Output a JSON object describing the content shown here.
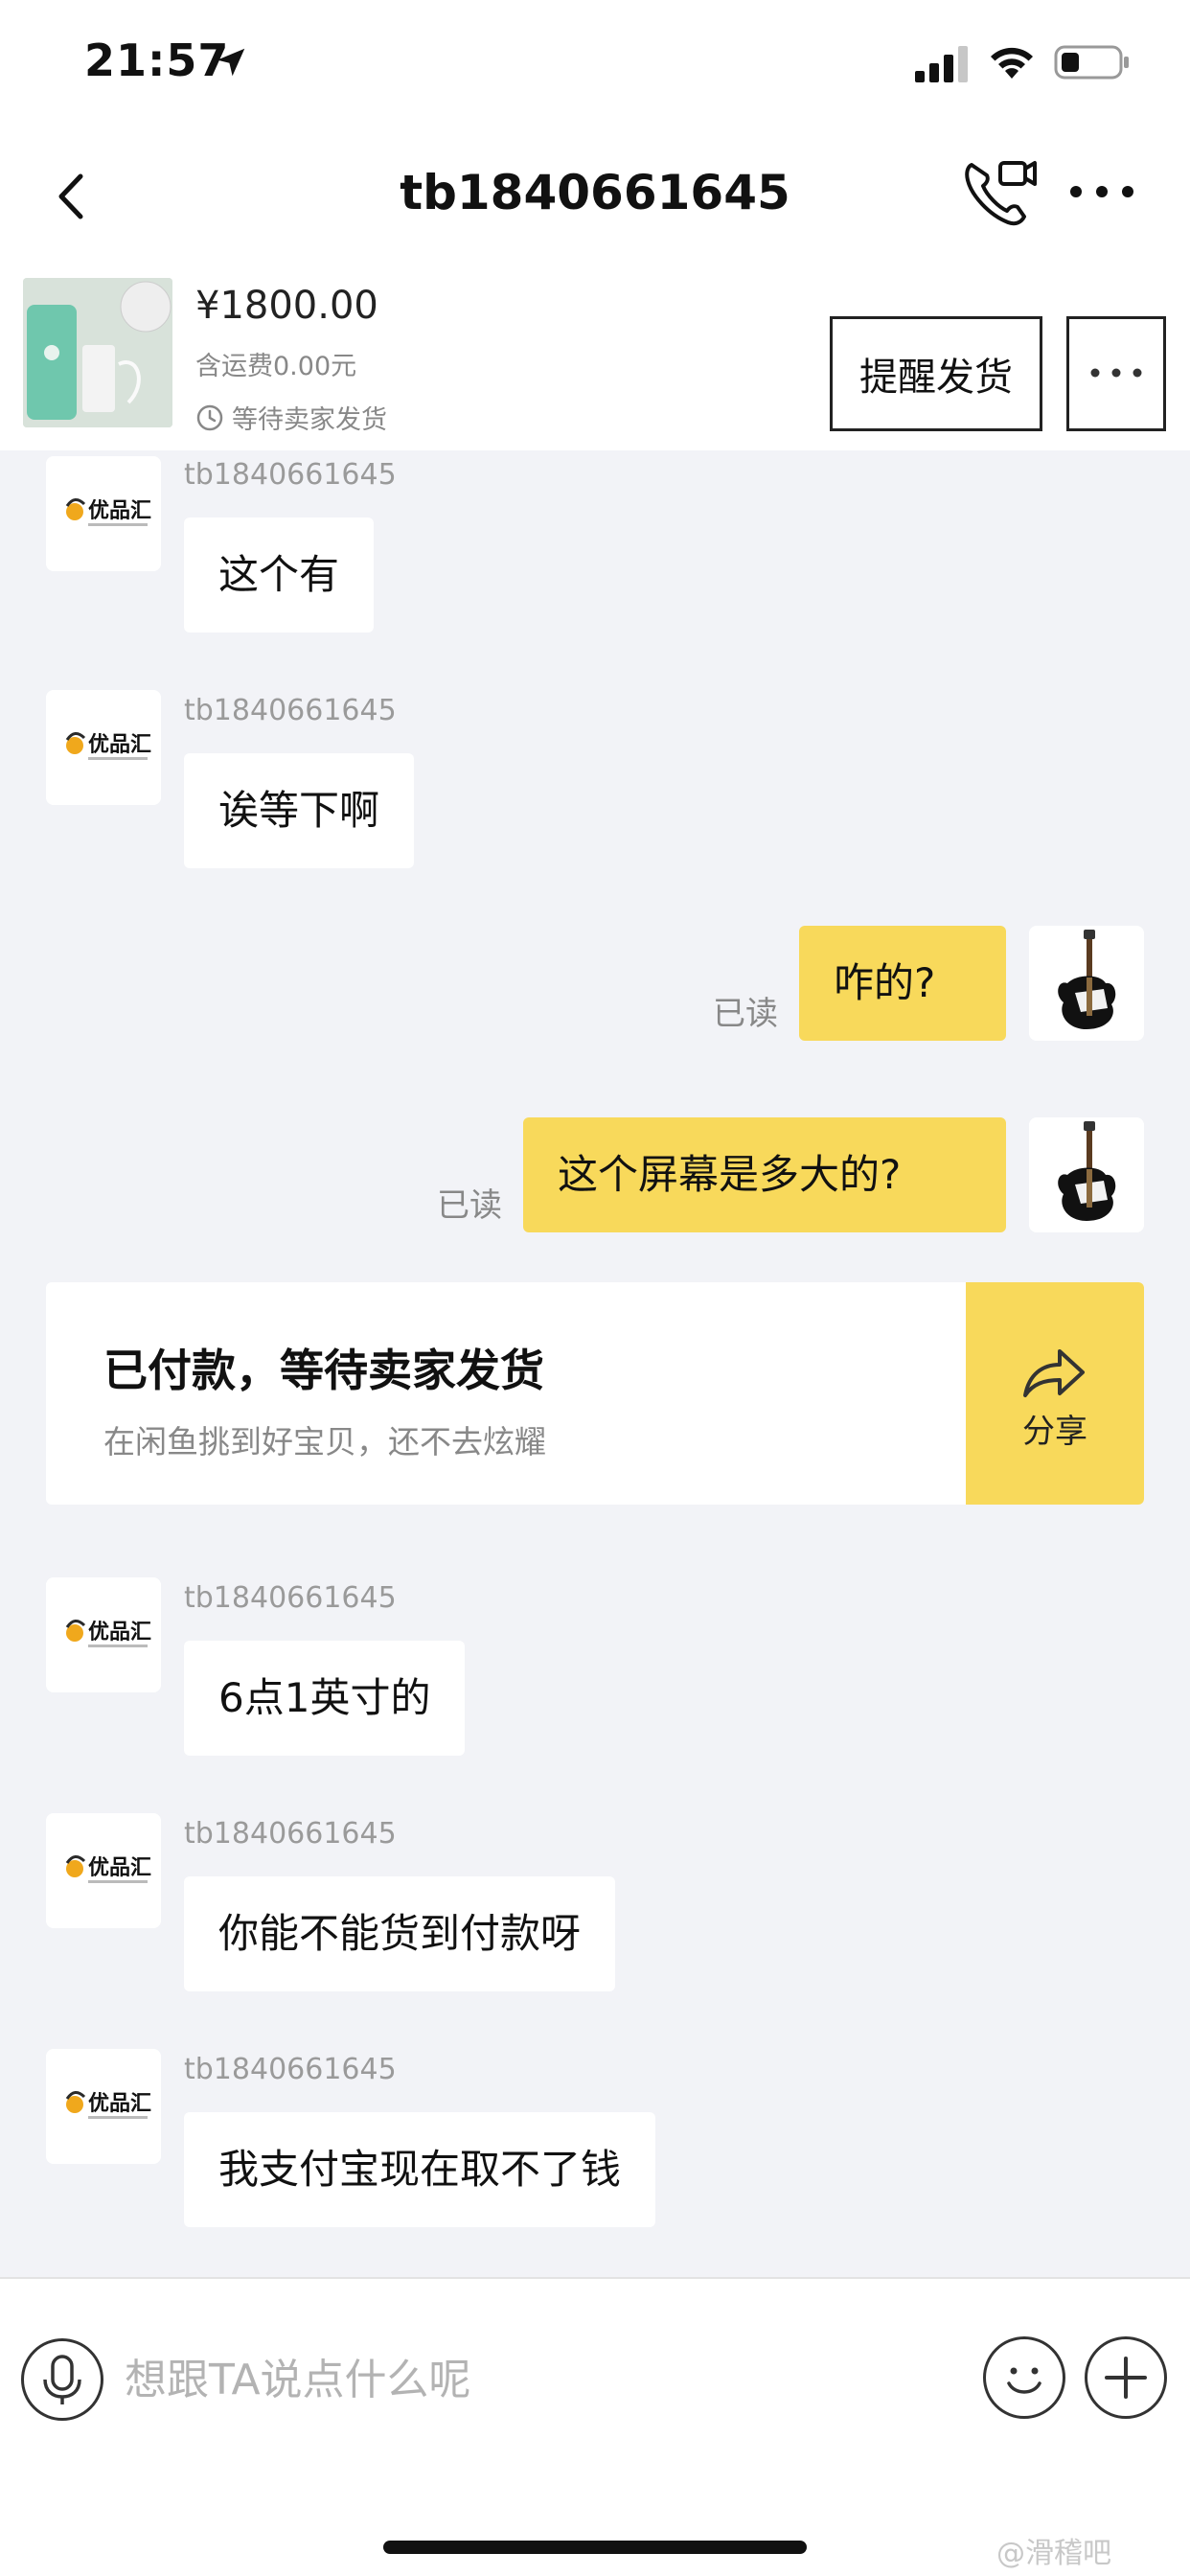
{
  "status_bar": {
    "time": "21:57",
    "icons": [
      "location-arrow-icon",
      "cellular-signal-icon",
      "wifi-icon",
      "battery-icon"
    ]
  },
  "nav": {
    "title": "tb1840661645",
    "icons": [
      "back-chevron-icon",
      "phone-video-call-icon",
      "more-dots-icon"
    ]
  },
  "product": {
    "price": "¥1800.00",
    "shipping": "含运费0.00元",
    "status": "等待卖家发货",
    "remind_button": "提醒发货"
  },
  "messages": {
    "m1": {
      "sender": "tb1840661645",
      "text": "这个有"
    },
    "m2": {
      "sender": "tb1840661645",
      "text": "诶等下啊"
    },
    "m3": {
      "text": "咋的?",
      "read": "已读"
    },
    "m4": {
      "text": "这个屏幕是多大的?",
      "read": "已读"
    },
    "m5": {
      "sender": "tb1840661645",
      "text": "6点1英寸的"
    },
    "m6": {
      "sender": "tb1840661645",
      "text": "你能不能货到付款呀"
    },
    "m7": {
      "sender": "tb1840661645",
      "text": "我支付宝现在取不了钱"
    }
  },
  "pay_card": {
    "title": "已付款，等待卖家发货",
    "subtitle": "在闲鱼挑到好宝贝，还不去炫耀",
    "share": "分享"
  },
  "seller_avatar": {
    "logo_text": "优品汇"
  },
  "input": {
    "placeholder": "想跟TA说点什么呢"
  },
  "watermark": "@滑稽吧",
  "colors": {
    "accent": "#f8d95b",
    "background": "#f2f3f7"
  }
}
